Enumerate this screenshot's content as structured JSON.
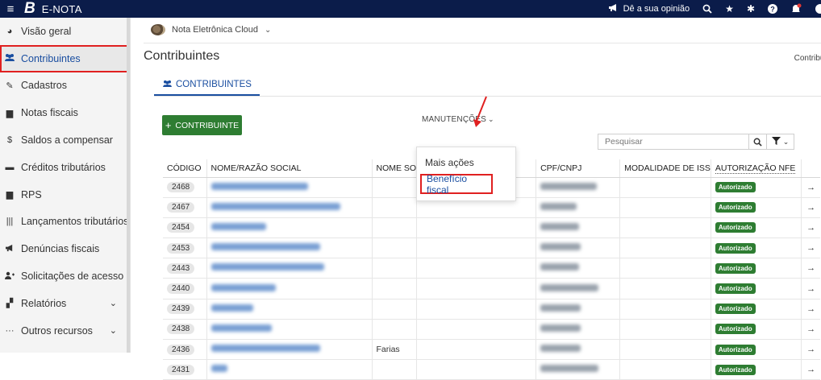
{
  "topbar": {
    "logo": "B",
    "app_name": "E-NOTA",
    "opinion_label": "Dê a sua opinião"
  },
  "sidebar": {
    "items": [
      {
        "label": "Visão geral",
        "icon": "pie-chart-icon"
      },
      {
        "label": "Contribuintes",
        "icon": "users-icon",
        "active": true
      },
      {
        "label": "Cadastros",
        "icon": "edit-icon"
      },
      {
        "label": "Notas fiscais",
        "icon": "file-icon"
      },
      {
        "label": "Saldos a compensar",
        "icon": "dollar-icon"
      },
      {
        "label": "Créditos tributários",
        "icon": "card-icon"
      },
      {
        "label": "RPS",
        "icon": "file-icon"
      },
      {
        "label": "Lançamentos tributários",
        "icon": "barcode-icon"
      },
      {
        "label": "Denúncias fiscais",
        "icon": "megaphone-icon"
      },
      {
        "label": "Solicitações de acesso",
        "icon": "user-plus-icon"
      },
      {
        "label": "Relatórios",
        "icon": "copy-icon",
        "expandable": true
      },
      {
        "label": "Outros recursos",
        "icon": "ellipsis-icon",
        "expandable": true
      }
    ]
  },
  "main": {
    "cloud_name": "Nota Eletrônica Cloud",
    "page_title": "Contribuintes",
    "breadcrumb": "Contribuir",
    "tab_label": "CONTRIBUINTES",
    "add_button": "CONTRIBUINTE",
    "maintenance_label": "MANUTENÇÕES",
    "search_placeholder": "Pesquisar",
    "dropdown": {
      "item1": "Mais ações",
      "item2": "Benefício fiscal"
    },
    "columns": [
      "CÓDIGO",
      "NOME/RAZÃO SOCIAL",
      "NOME SO",
      "",
      "CPF/CNPJ",
      "MODALIDADE DE ISS",
      "AUTORIZAÇÃO NFE",
      ""
    ],
    "rows": [
      {
        "code": "2468",
        "fantasy": "",
        "status": "Autorizado"
      },
      {
        "code": "2467",
        "fantasy": "",
        "status": "Autorizado"
      },
      {
        "code": "2454",
        "fantasy": "",
        "status": "Autorizado"
      },
      {
        "code": "2453",
        "fantasy": "",
        "status": "Autorizado"
      },
      {
        "code": "2443",
        "fantasy": "",
        "status": "Autorizado"
      },
      {
        "code": "2440",
        "fantasy": "",
        "status": "Autorizado"
      },
      {
        "code": "2439",
        "fantasy": "",
        "status": "Autorizado"
      },
      {
        "code": "2438",
        "fantasy": "",
        "status": "Autorizado"
      },
      {
        "code": "2436",
        "fantasy": "Farias",
        "status": "Autorizado"
      },
      {
        "code": "2431",
        "fantasy": "",
        "status": "Autorizado"
      }
    ]
  },
  "colors": {
    "topbar_bg": "#0b1c4a",
    "accent_blue": "#1a4ea0",
    "green": "#2e7d32",
    "highlight_red": "#e02020"
  }
}
